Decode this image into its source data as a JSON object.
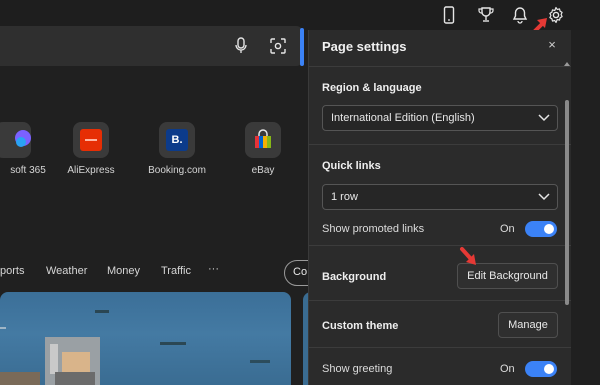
{
  "topbar": {
    "icons": [
      "phone-icon",
      "trophy-icon",
      "bell-icon",
      "gear-icon"
    ]
  },
  "search": {
    "icons": [
      "microphone-icon",
      "visual-search-icon"
    ]
  },
  "quick_links": [
    {
      "label": "soft 365",
      "icon": "microsoft365-icon"
    },
    {
      "label": "AliExpress",
      "icon": "aliexpress-icon"
    },
    {
      "label": "Booking.com",
      "icon": "booking-icon",
      "glyph": "B."
    },
    {
      "label": "eBay",
      "icon": "ebay-icon"
    }
  ],
  "nav": {
    "items": [
      "Sports",
      "Weather",
      "Money",
      "Traffic"
    ],
    "sports_partial": "ports",
    "more": "···",
    "co": "Co"
  },
  "panel": {
    "title": "Page settings",
    "close": "×",
    "region_label": "Region & language",
    "region_value": "International Edition (English)",
    "quick_links_label": "Quick links",
    "quick_links_value": "1 row",
    "promoted_label": "Show promoted links",
    "promoted_state": "On",
    "background_label": "Background",
    "edit_background": "Edit Background",
    "theme_label": "Custom theme",
    "manage": "Manage",
    "greeting_label": "Show greeting",
    "greeting_state": "On"
  },
  "colors": {
    "accent": "#3b82f6",
    "annotation_arrow": "#e53935",
    "panel_bg": "#2b2b2b",
    "page_bg": "#202020"
  }
}
